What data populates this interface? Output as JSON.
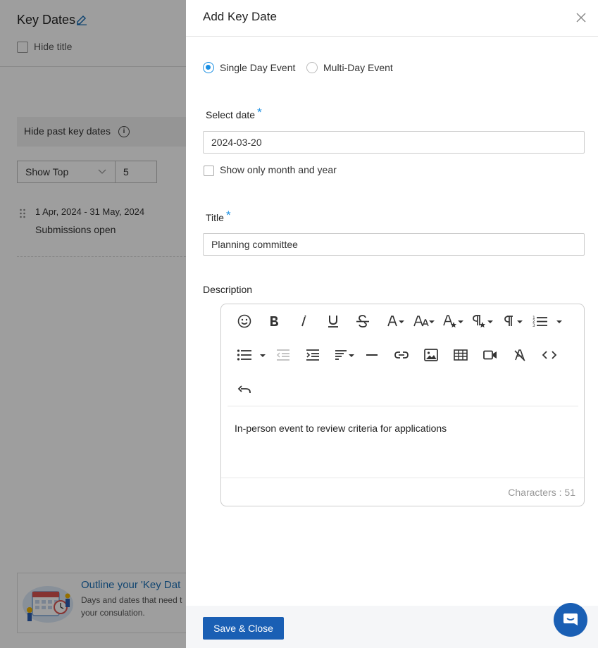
{
  "background": {
    "page_title": "Key Dates",
    "hide_title_label": "Hide title",
    "hide_past_label": "Hide past key dates",
    "show_select_value": "Show Top",
    "show_count_value": "5",
    "key_date_item": {
      "date_range": "1 Apr, 2024 - 31 May, 2024",
      "title": "Submissions open"
    },
    "promo": {
      "title": "Outline your 'Key Dat",
      "text": "Days and dates that need t your consulation."
    }
  },
  "drawer": {
    "title": "Add Key Date",
    "event_type": {
      "options": [
        "Single Day Event",
        "Multi-Day Event"
      ],
      "selected": "Single Day Event"
    },
    "select_date_label": "Select date",
    "required_mark": "*",
    "date_value": "2024-03-20",
    "month_year_label": "Show only month and year",
    "title_label": "Title",
    "title_value": "Planning committee",
    "description_label": "Description",
    "editor": {
      "content": "In-person event to review criteria for applications",
      "char_count": "Characters : 51"
    },
    "save_label": "Save & Close"
  },
  "colors": {
    "accent": "#1a8fe3",
    "primary_button": "#1a5fb4",
    "promo_link": "#1a6fb5"
  }
}
